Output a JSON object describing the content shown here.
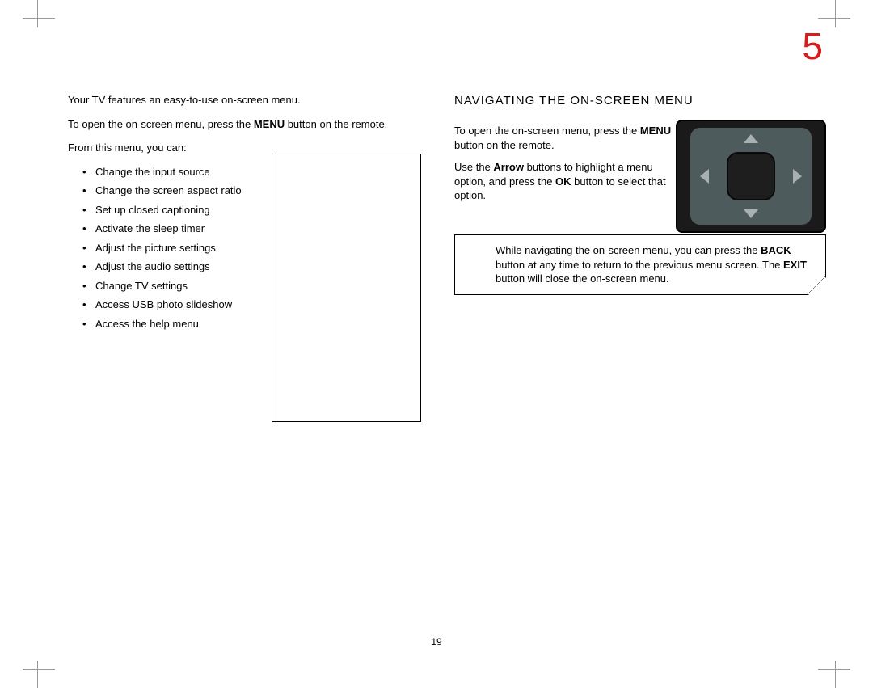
{
  "chapter_number": "5",
  "page_number": "19",
  "left": {
    "intro": "Your TV features an easy-to-use on-screen menu.",
    "open_pre": "To open the on-screen menu, press the ",
    "open_bold": "MENU",
    "open_post": " button on the remote.",
    "list_intro": "From this menu, you can:",
    "items": [
      "Change the input source",
      "Change the screen aspect ratio",
      "Set up closed captioning",
      "Activate the sleep timer",
      "Adjust the picture settings",
      "Adjust the audio settings",
      "Change TV settings",
      "Access USB photo slideshow",
      "Access the help menu"
    ]
  },
  "right": {
    "title": "NAVIGATING THE ON-SCREEN MENU",
    "p1_pre": "To open the on-screen menu, press the ",
    "p1_bold": "MENU",
    "p1_post": " button on the remote.",
    "p2_pre": "Use the ",
    "p2_b1": "Arrow",
    "p2_mid": " buttons to highlight a menu option, and press the ",
    "p2_b2": "OK",
    "p2_post": " button to select that option.",
    "note_pre": "While navigating the on-screen menu, you can press the ",
    "note_b1": "BACK",
    "note_mid": " button at any time to return to the previous menu screen. The ",
    "note_b2": "EXIT",
    "note_post": " button will close the on-screen menu."
  }
}
